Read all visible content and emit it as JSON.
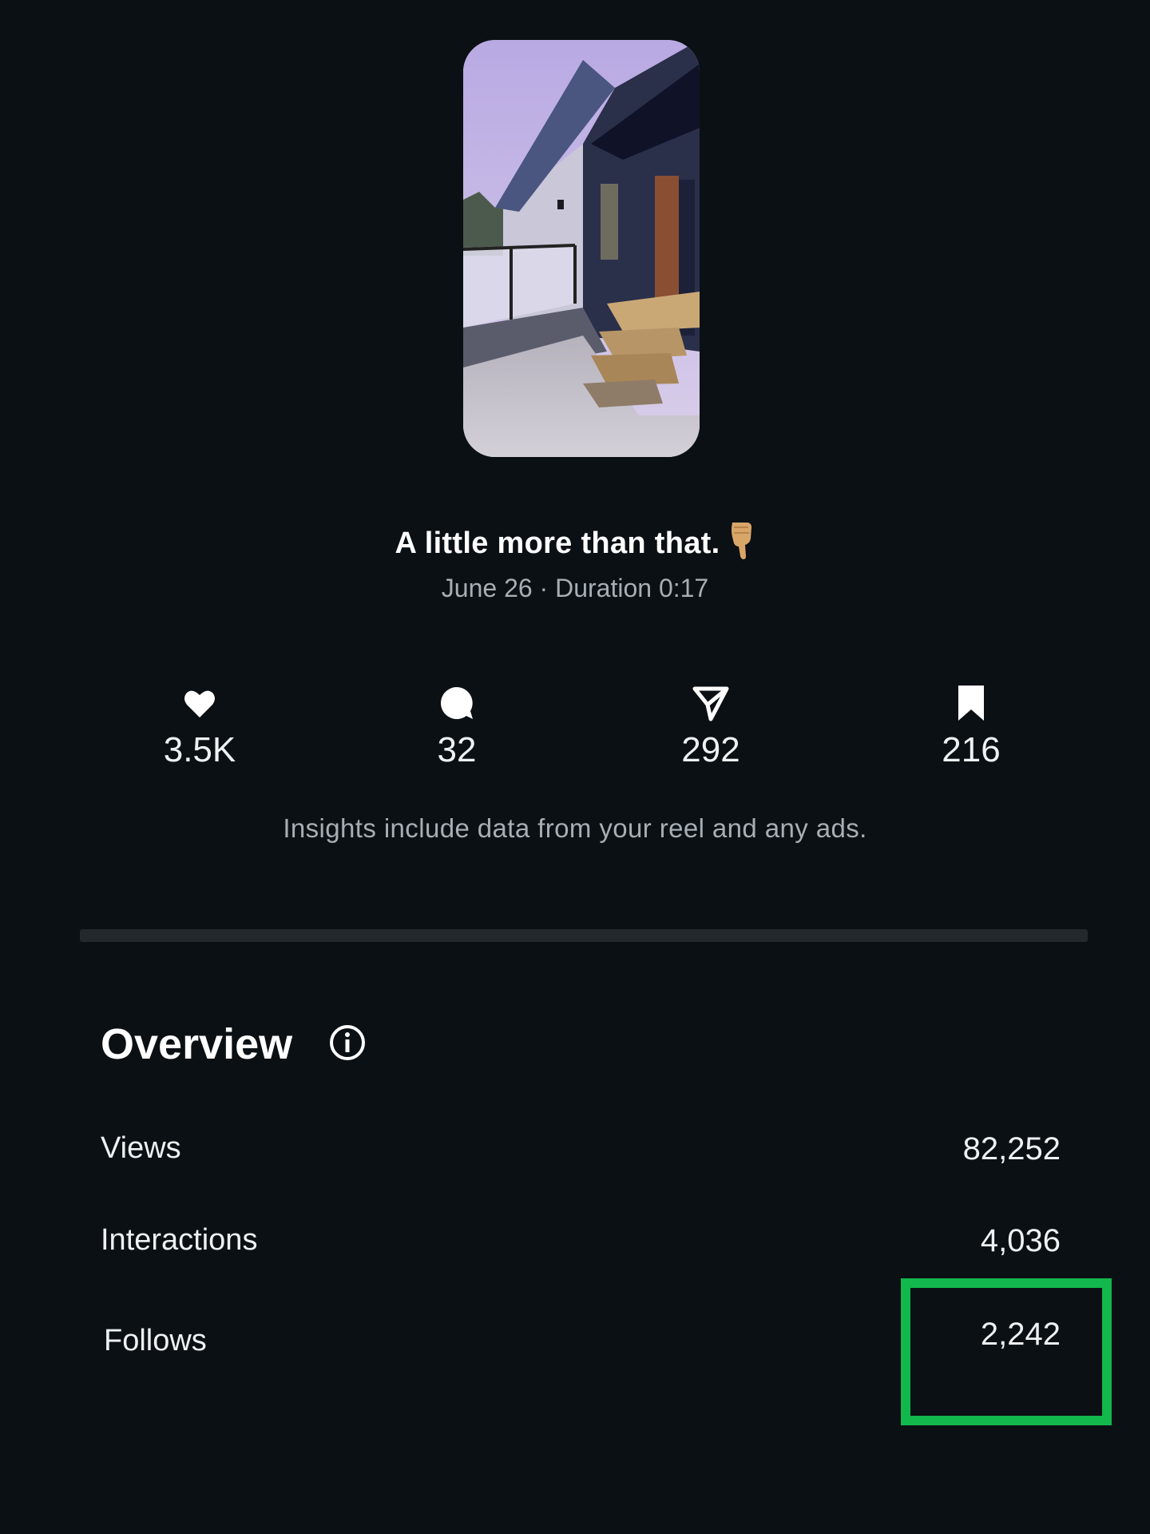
{
  "reel": {
    "thumbnail_alt": "",
    "caption": "A little more than that.",
    "caption_emoji": "pointing-down-hand-emoji",
    "subline": "June 26 · Duration 0:17"
  },
  "stats": [
    {
      "icon": "heart-icon",
      "value": "3.5K"
    },
    {
      "icon": "comment-icon",
      "value": "32"
    },
    {
      "icon": "share-icon",
      "value": "292"
    },
    {
      "icon": "bookmark-icon",
      "value": "216"
    }
  ],
  "note": "Insights include data from your reel and any ads.",
  "overview": {
    "title": "Overview",
    "info_icon": "info-icon",
    "rows": [
      {
        "label": "Views",
        "value": "82,252"
      },
      {
        "label": "Interactions",
        "value": "4,036"
      },
      {
        "label": "Follows",
        "value": "2,242"
      }
    ]
  },
  "colors": {
    "background": "#0b1014",
    "highlight": "#12b84c",
    "muted_text": "#a7aeb4"
  }
}
